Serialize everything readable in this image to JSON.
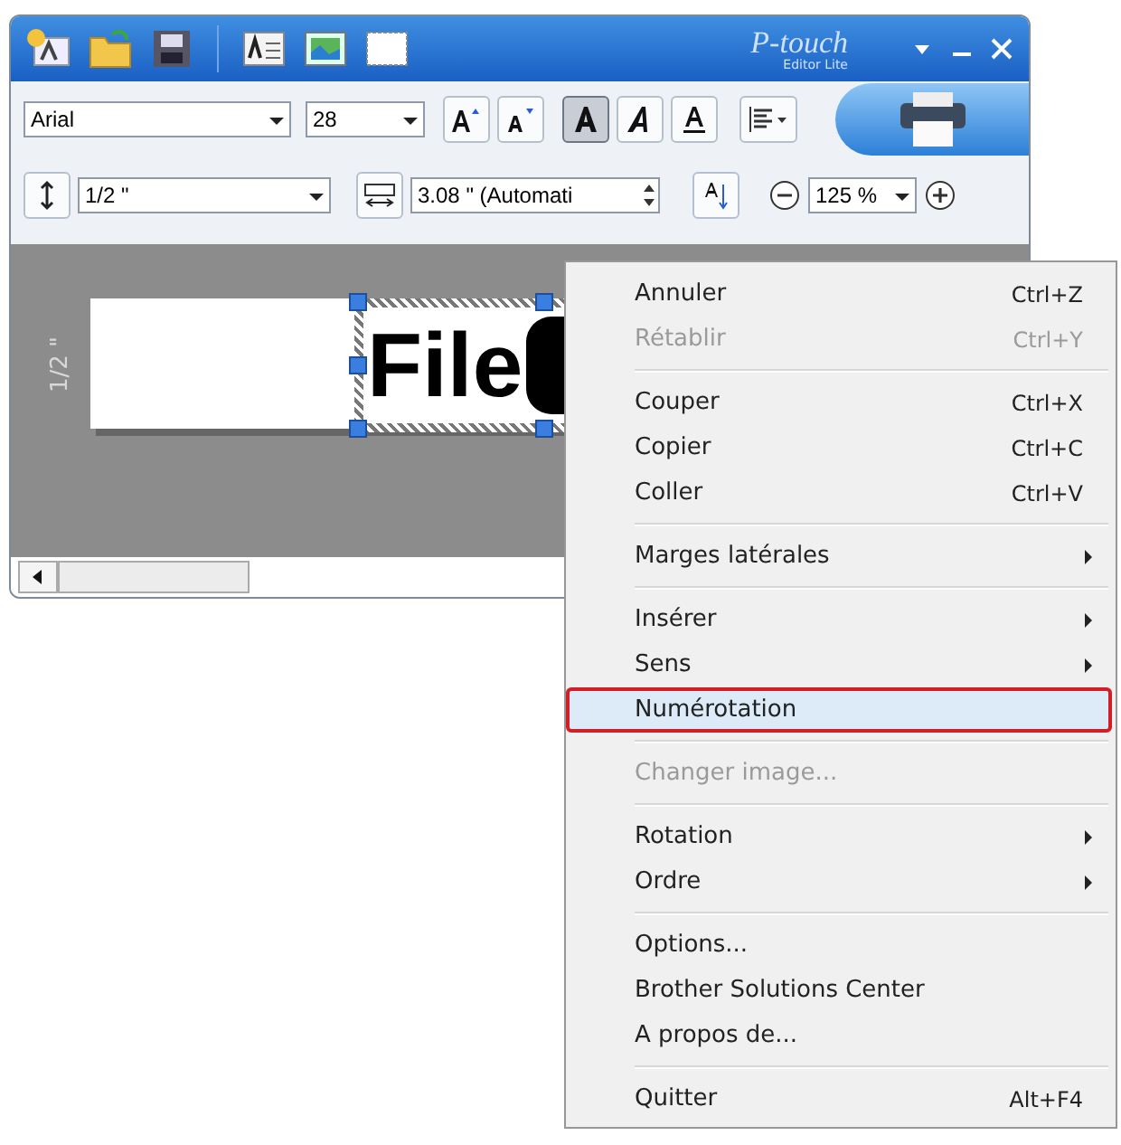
{
  "window": {
    "logo": "P-touch",
    "logo_sub": "Editor Lite"
  },
  "toolbar": {
    "font": "Arial",
    "size": "28",
    "styles": [
      {
        "kind": "bold",
        "selected": true
      },
      {
        "kind": "italic",
        "selected": false
      },
      {
        "kind": "underline",
        "selected": false
      }
    ],
    "tape": "1/2 \"",
    "length": "3.08 \" (Automati",
    "zoom": "125 %"
  },
  "canvas": {
    "ruler": "1/2 \"",
    "label_text": "File"
  },
  "menu": [
    {
      "kind": "item",
      "label": "Annuler",
      "shortcut": "Ctrl+Z",
      "disabled": false,
      "submenu": false,
      "selected": false
    },
    {
      "kind": "item",
      "label": "Rétablir",
      "shortcut": "Ctrl+Y",
      "disabled": true,
      "submenu": false,
      "selected": false
    },
    {
      "kind": "separator"
    },
    {
      "kind": "item",
      "label": "Couper",
      "shortcut": "Ctrl+X",
      "disabled": false,
      "submenu": false,
      "selected": false
    },
    {
      "kind": "item",
      "label": "Copier",
      "shortcut": "Ctrl+C",
      "disabled": false,
      "submenu": false,
      "selected": false
    },
    {
      "kind": "item",
      "label": "Coller",
      "shortcut": "Ctrl+V",
      "disabled": false,
      "submenu": false,
      "selected": false
    },
    {
      "kind": "separator"
    },
    {
      "kind": "item",
      "label": "Marges latérales",
      "disabled": false,
      "submenu": true,
      "selected": false
    },
    {
      "kind": "separator"
    },
    {
      "kind": "item",
      "label": "Insérer",
      "disabled": false,
      "submenu": true,
      "selected": false
    },
    {
      "kind": "item",
      "label": "Sens",
      "disabled": false,
      "submenu": true,
      "selected": false
    },
    {
      "kind": "item",
      "label": "Numérotation",
      "disabled": false,
      "submenu": false,
      "selected": true
    },
    {
      "kind": "separator"
    },
    {
      "kind": "item",
      "label": "Changer image...",
      "disabled": true,
      "submenu": false,
      "selected": false
    },
    {
      "kind": "separator"
    },
    {
      "kind": "item",
      "label": "Rotation",
      "disabled": false,
      "submenu": true,
      "selected": false
    },
    {
      "kind": "item",
      "label": "Ordre",
      "disabled": false,
      "submenu": true,
      "selected": false
    },
    {
      "kind": "separator"
    },
    {
      "kind": "item",
      "label": "Options...",
      "disabled": false,
      "submenu": false,
      "selected": false
    },
    {
      "kind": "item",
      "label": "Brother Solutions Center",
      "disabled": false,
      "submenu": false,
      "selected": false
    },
    {
      "kind": "item",
      "label": "A propos de...",
      "disabled": false,
      "submenu": false,
      "selected": false
    },
    {
      "kind": "separator"
    },
    {
      "kind": "item",
      "label": "Quitter",
      "shortcut": "Alt+F4",
      "disabled": false,
      "submenu": false,
      "selected": false
    }
  ]
}
